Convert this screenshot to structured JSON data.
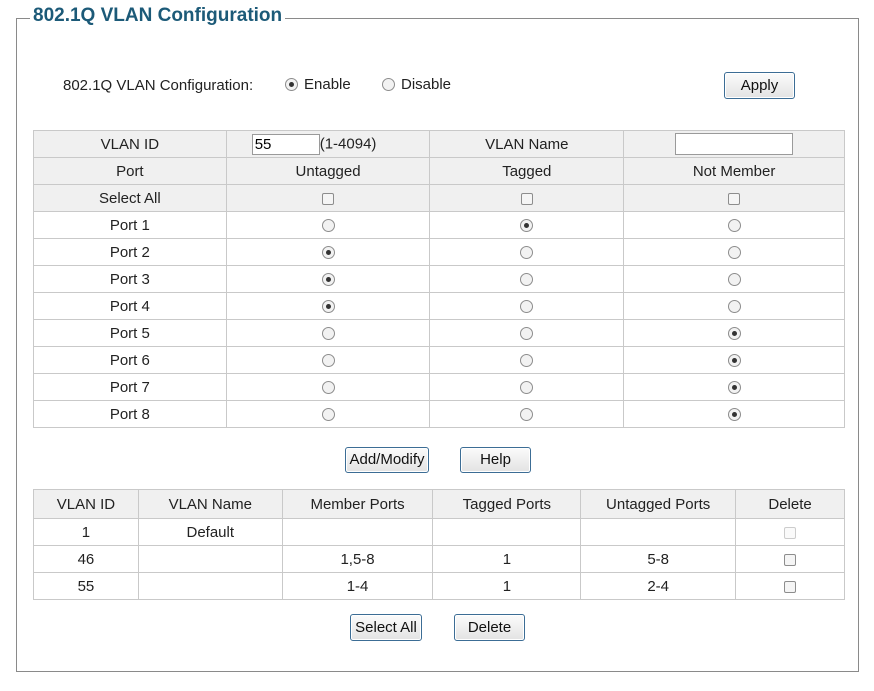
{
  "title": "802.1Q VLAN Configuration",
  "config": {
    "label": "802.1Q VLAN Configuration:",
    "enable_label": "Enable",
    "disable_label": "Disable",
    "selected": "enable",
    "apply_label": "Apply"
  },
  "form": {
    "vlan_id_label": "VLAN ID",
    "vlan_id_value": "55",
    "vlan_id_range": "(1-4094)",
    "vlan_name_label": "VLAN Name",
    "vlan_name_value": "",
    "col_port": "Port",
    "col_untagged": "Untagged",
    "col_tagged": "Tagged",
    "col_not_member": "Not Member",
    "select_all_label": "Select All",
    "ports": [
      {
        "name": "Port 1",
        "mode": "tagged"
      },
      {
        "name": "Port 2",
        "mode": "untagged"
      },
      {
        "name": "Port 3",
        "mode": "untagged"
      },
      {
        "name": "Port 4",
        "mode": "untagged"
      },
      {
        "name": "Port 5",
        "mode": "not_member"
      },
      {
        "name": "Port 6",
        "mode": "not_member"
      },
      {
        "name": "Port 7",
        "mode": "not_member"
      },
      {
        "name": "Port 8",
        "mode": "not_member"
      }
    ]
  },
  "actions": {
    "add_modify_label": "Add/Modify",
    "help_label": "Help"
  },
  "vlan_table": {
    "headers": [
      "VLAN ID",
      "VLAN Name",
      "Member Ports",
      "Tagged Ports",
      "Untagged Ports",
      "Delete"
    ],
    "rows": [
      {
        "id": "1",
        "name": "Default",
        "member": "",
        "tagged": "",
        "untagged": "",
        "deletable": false
      },
      {
        "id": "46",
        "name": "",
        "member": "1,5-8",
        "tagged": "1",
        "untagged": "5-8",
        "deletable": true
      },
      {
        "id": "55",
        "name": "",
        "member": "1-4",
        "tagged": "1",
        "untagged": "2-4",
        "deletable": true
      }
    ]
  },
  "bottom": {
    "select_all_label": "Select All",
    "delete_label": "Delete"
  }
}
